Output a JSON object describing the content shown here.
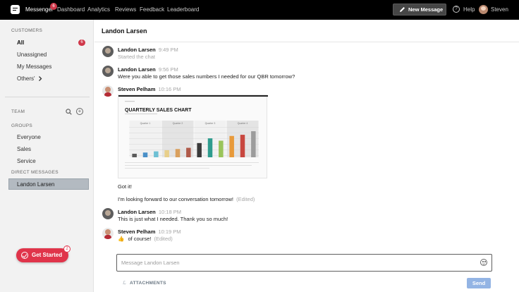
{
  "nav": {
    "app_label": "Messenger",
    "app_badge": "6",
    "items": [
      "Dashboard",
      "Analytics",
      "Reviews",
      "Feedback",
      "Leaderboard"
    ],
    "new_message": "New Message",
    "help": "Help",
    "user": "Steven"
  },
  "sidebar": {
    "customers_head": "CUSTOMERS",
    "customers": [
      {
        "label": "All",
        "badge": "6"
      },
      {
        "label": "Unassigned"
      },
      {
        "label": "My Messages"
      },
      {
        "label": "Others'"
      }
    ],
    "team_head": "TEAM",
    "groups_head": "GROUPS",
    "groups": [
      "Everyone",
      "Sales",
      "Service"
    ],
    "dm_head": "DIRECT MESSAGES",
    "dms": [
      "Landon Larsen"
    ]
  },
  "get_started": {
    "label": "Get Started",
    "badge": "2"
  },
  "conversation": {
    "title": "Landon Larsen",
    "messages": [
      {
        "sender": "Landon Larsen",
        "time": "9:49 PM",
        "lines": [
          "Started the chat"
        ]
      },
      {
        "sender": "Landon Larsen",
        "time": "9:56 PM",
        "lines": [
          "Were you able to get those sales numbers I needed for our QBR tomorrow?"
        ]
      },
      {
        "sender": "Steven Pelham",
        "time": "10:16 PM",
        "lines": [
          "Got it!",
          "I'm looking forward to our conversation tomorrow!"
        ],
        "edited": "(Edited)"
      },
      {
        "sender": "Landon Larsen",
        "time": "10:18 PM",
        "lines": [
          "This is just what I needed. Thank you so much!"
        ]
      },
      {
        "sender": "Steven Pelham",
        "time": "10:19 PM",
        "lines": [
          "of course!"
        ],
        "edited": "(Edited)"
      }
    ],
    "attachment": {
      "title": "QUARTERLY SALES CHART",
      "quarters": [
        "Quarter 1",
        "Quarter 2",
        "Quarter 3",
        "Quarter 4"
      ],
      "colors": [
        "#5b5b5b",
        "#4a90c8",
        "#6ec0d4",
        "#e8cf8a",
        "#d9a05e",
        "#b05a4a",
        "#3a3a3a",
        "#2e9c8e",
        "#9ac45a",
        "#e89a3a",
        "#c8473f",
        "#9c9c9c"
      ],
      "values": [
        3,
        4,
        5,
        6,
        7,
        8,
        12,
        16,
        14,
        18,
        19,
        22
      ]
    }
  },
  "composer": {
    "placeholder": "Message Landon Larsen",
    "attachments": "ATTACHMENTS",
    "send": "Send"
  },
  "colors": {
    "accent": "#e0344a",
    "send": "#93b4e4",
    "topbar": "#000000"
  }
}
